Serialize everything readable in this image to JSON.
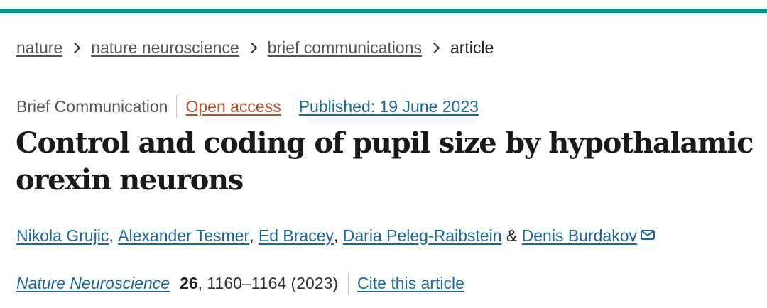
{
  "breadcrumb": {
    "items": [
      "nature",
      "nature neuroscience",
      "brief communications"
    ],
    "current": "article"
  },
  "meta": {
    "article_type": "Brief Communication",
    "open_access": "Open access",
    "published": "Published: 19 June 2023"
  },
  "title": "Control and coding of pupil size by hypothalamic orexin neurons",
  "authors": {
    "list": [
      "Nikola Grujic",
      "Alexander Tesmer",
      "Ed Bracey",
      "Daria Peleg-Raibstein",
      "Denis Burdakov"
    ],
    "separator": ",",
    "ampersand": "&"
  },
  "citation": {
    "journal": "Nature Neuroscience",
    "volume": "26",
    "pages_year": ", 1160–1164 (2023)",
    "cite_label": "Cite this article"
  },
  "icons": {
    "top_bar": "accent-bar",
    "separator": "chevron-right-icon",
    "email": "email-icon"
  },
  "colors": {
    "accent": "#0d8e8a",
    "link": "#1a6a98",
    "open_access": "#b3552f",
    "muted": "#555555"
  }
}
